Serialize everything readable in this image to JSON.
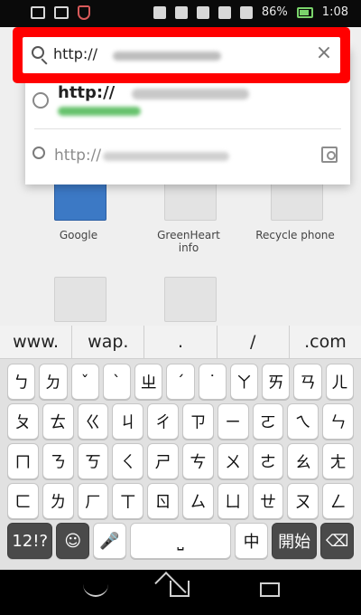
{
  "status": {
    "battery_percent": "86%",
    "time": "1:08"
  },
  "browser": {
    "url_value": "http://",
    "close_symbol": "×",
    "suggestions": [
      {
        "title_prefix": "http://"
      },
      {
        "query_prefix": "http://"
      }
    ],
    "tiles": [
      {
        "label": "Google"
      },
      {
        "label": "GreenHeart\ninfo"
      },
      {
        "label": "Recycle phone"
      }
    ]
  },
  "keyboard": {
    "suggestions": [
      "www.",
      "wap.",
      ".",
      "/",
      ".com"
    ],
    "rows": [
      [
        "ㄅ",
        "ㄉ",
        "ˇ",
        "ˋ",
        "ㄓ",
        "ˊ",
        "˙",
        "ㄚ",
        "ㄞ",
        "ㄢ",
        "ㄦ"
      ],
      [
        "ㄆ",
        "ㄊ",
        "ㄍ",
        "ㄐ",
        "ㄔ",
        "ㄗ",
        "ㄧ",
        "ㄛ",
        "ㄟ",
        "ㄣ"
      ],
      [
        "ㄇ",
        "ㄋ",
        "ㄎ",
        "ㄑ",
        "ㄕ",
        "ㄘ",
        "ㄨ",
        "ㄜ",
        "ㄠ",
        "ㄤ"
      ],
      [
        "ㄈ",
        "ㄌ",
        "ㄏ",
        "ㄒ",
        "ㄖ",
        "ㄙ",
        "ㄩ",
        "ㄝ",
        "ㄡ",
        "ㄥ"
      ]
    ],
    "bottom": {
      "num_label": "12!?",
      "emoji": "☺",
      "mic": "🎤",
      "space": "⎵",
      "zhuyin_label": "中",
      "start_label": "開始",
      "backspace": "⌫"
    }
  }
}
